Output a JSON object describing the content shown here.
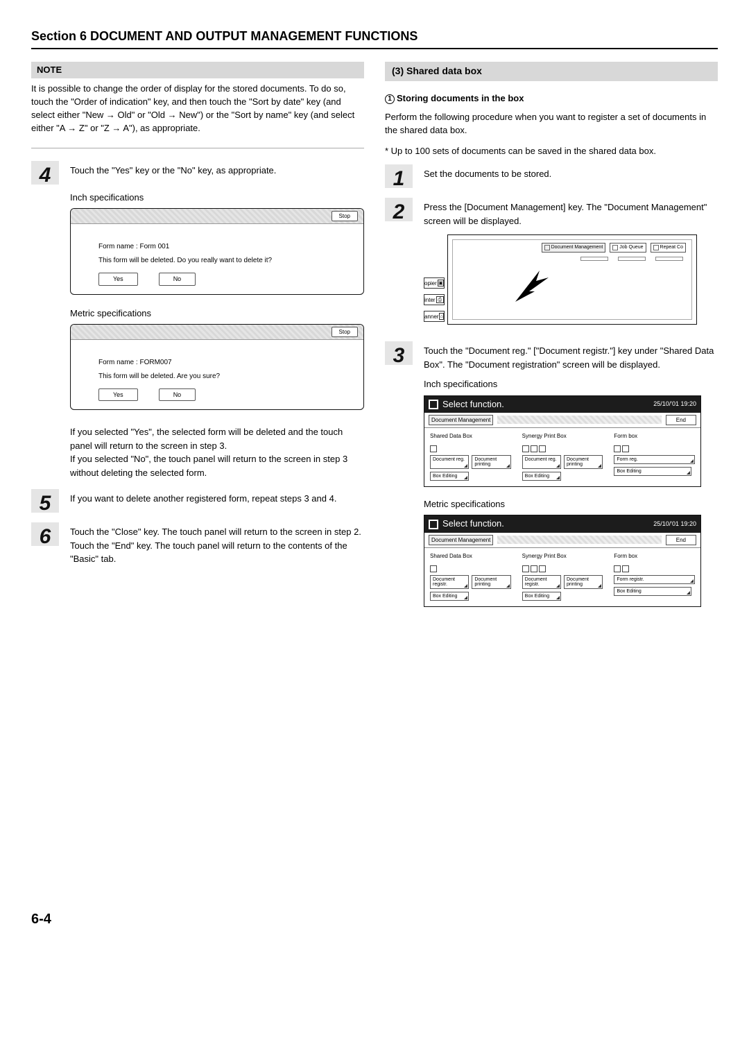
{
  "header": {
    "title": "Section 6  DOCUMENT AND OUTPUT MANAGEMENT FUNCTIONS"
  },
  "left": {
    "note_label": "NOTE",
    "note_text": "It is possible to change the order of display for the stored documents. To do so, touch the \"Order of indication\" key, and then touch the \"Sort by date\" key (and select either \"New → Old\" or \"Old → New\") or the \"Sort by name\" key (and select either \"A → Z\" or \"Z → A\"), as appropriate.",
    "step4": {
      "num": "4",
      "text": "Touch the \"Yes\" key or the \"No\" key, as appropriate."
    },
    "spec_inch": "Inch specifications",
    "panel_inch": {
      "stop": "Stop",
      "line1": "Form name : Form 001",
      "line2": "This form will be deleted. Do you really want to delete it?",
      "yes": "Yes",
      "no": "No"
    },
    "spec_metric": "Metric specifications",
    "panel_metric": {
      "stop": "Stop",
      "line1": "Form name : FORM007",
      "line2": "This form will be deleted. Are you sure?",
      "yes": "Yes",
      "no": "No"
    },
    "result_text": "If you selected \"Yes\", the selected form will be deleted and the touch panel will return to the screen in step 3.\nIf you selected \"No\", the touch panel will return to the screen in step 3 without deleting the selected form.",
    "step5": {
      "num": "5",
      "text": "If you want to delete another registered form, repeat steps 3 and 4."
    },
    "step6": {
      "num": "6",
      "text1": "Touch the \"Close\" key. The touch panel will return to the screen in step 2.",
      "text2": "Touch the \"End\" key. The touch panel will return to the contents of the \"Basic\" tab."
    }
  },
  "right": {
    "section_head": "(3)  Shared data box",
    "sub_head": "Storing documents in the box",
    "sub_head_num": "1",
    "intro1": "Perform the following procedure when you want to register a set of documents in the shared data box.",
    "intro2": "* Up to 100 sets of documents can be saved in the shared data box.",
    "step1": {
      "num": "1",
      "text": "Set the documents to be stored."
    },
    "step2": {
      "num": "2",
      "text": "Press the [Document Management] key. The \"Document Management\" screen will be displayed."
    },
    "panel2": {
      "tab1": "Document Management",
      "tab2": "Job Queue",
      "tab3": "Repeat Co",
      "phys1": "opier",
      "phys2": "inter",
      "phys3": "anner"
    },
    "step3": {
      "num": "3",
      "text": "Touch the \"Document reg.\" [\"Document registr.\"] key under \"Shared Data Box\". The \"Document registration\" screen will be displayed."
    },
    "spec_inch": "Inch specifications",
    "sf_inch": {
      "title": "Select function.",
      "time": "25/10/'01 19:20",
      "status": "Document Management",
      "end": "End",
      "col1_title": "Shared Data Box",
      "col2_title": "Synergy Print Box",
      "col3_title": "Form box",
      "b_docreg": "Document reg.",
      "b_docprint": "Document printing",
      "b_formreg": "Form reg.",
      "b_boxedit": "Box Editing"
    },
    "spec_metric": "Metric specifications",
    "sf_metric": {
      "title": "Select function.",
      "time": "25/10/'01  19:20",
      "status": "Document Management",
      "end": "End",
      "col1_title": "Shared Data Box",
      "col2_title": "Synergy Print Box",
      "col3_title": "Form box",
      "b_docreg": "Document registr.",
      "b_docprint": "Document printing",
      "b_formreg": "Form registr.",
      "b_boxedit": "Box Editing"
    }
  },
  "page_num": "6-4"
}
